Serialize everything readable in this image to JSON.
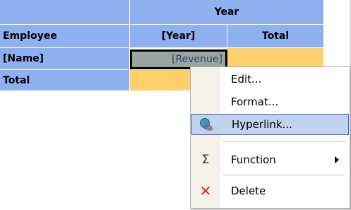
{
  "pivot": {
    "year_header": "Year",
    "employee_header": "Employee",
    "year_col": "[Year]",
    "total_col": "Total",
    "name_cell": "[Name]",
    "revenue_cell": "[Revenue]",
    "total_row": "Total"
  },
  "menu": {
    "items": [
      {
        "label": "Edit...",
        "icon": ""
      },
      {
        "label": "Format...",
        "icon": ""
      },
      {
        "label": "Hyperlink...",
        "icon": "globe-link-icon"
      },
      {
        "label": "Function",
        "icon": "sigma-icon",
        "glyph": "Σ"
      },
      {
        "label": "Delete",
        "icon": "delete-x-icon",
        "glyph": "✕"
      }
    ]
  },
  "colors": {
    "header_blue": "#8fb0ef",
    "total_orange": "#ffd06b",
    "menu_highlight": "#c1d2ee",
    "delete_red": "#e02020"
  }
}
